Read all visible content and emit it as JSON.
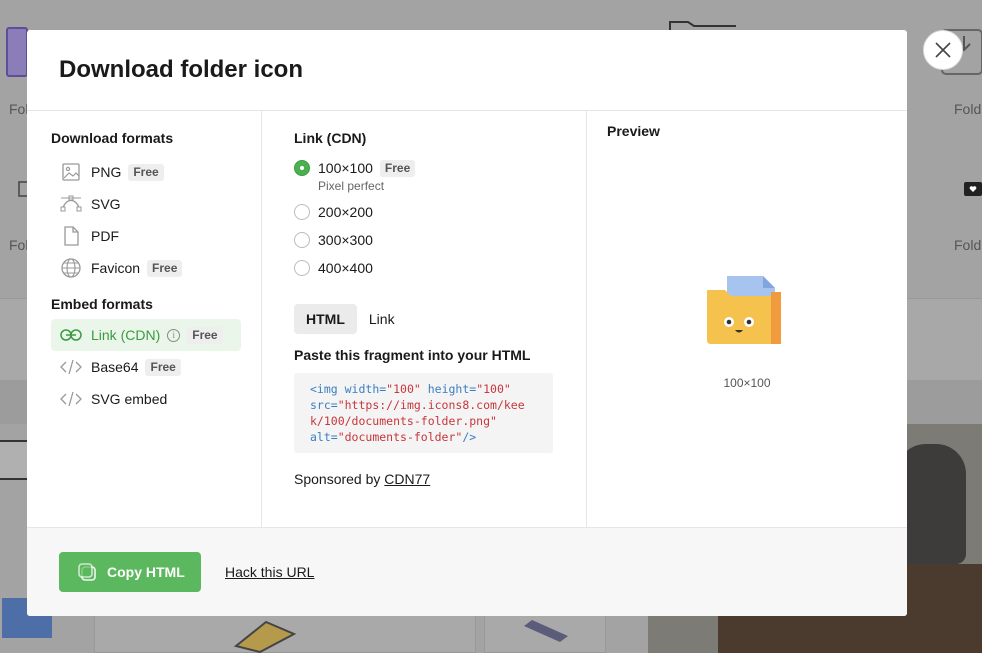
{
  "background": {
    "labels": [
      "Fol",
      "Fold",
      "Fol",
      "Fold"
    ]
  },
  "modal": {
    "title": "Download folder icon",
    "close_icon": "close-icon"
  },
  "download_formats": {
    "heading": "Download formats",
    "items": [
      {
        "label": "PNG",
        "badge": "Free",
        "icon": "image-icon"
      },
      {
        "label": "SVG",
        "badge": "",
        "icon": "vector-icon"
      },
      {
        "label": "PDF",
        "badge": "",
        "icon": "file-icon"
      },
      {
        "label": "Favicon",
        "badge": "Free",
        "icon": "globe-icon"
      }
    ]
  },
  "embed_formats": {
    "heading": "Embed formats",
    "items": [
      {
        "label": "Link (CDN)",
        "badge": "Free",
        "icon": "link-icon",
        "info": "i",
        "active": true
      },
      {
        "label": "Base64",
        "badge": "Free",
        "icon": "code-icon"
      },
      {
        "label": "SVG embed",
        "badge": "",
        "icon": "code-icon"
      }
    ]
  },
  "link_cdn": {
    "heading": "Link (CDN)",
    "sizes": [
      {
        "label": "100×100",
        "badge": "Free",
        "sub": "Pixel perfect",
        "selected": true
      },
      {
        "label": "200×200",
        "selected": false
      },
      {
        "label": "300×300",
        "selected": false
      },
      {
        "label": "400×400",
        "selected": false
      }
    ],
    "tabs": [
      "HTML",
      "Link"
    ],
    "active_tab": "HTML",
    "paste_heading": "Paste this fragment into your HTML",
    "code": {
      "l1_open": "<img ",
      "l1_a1": "width=",
      "l1_v1": "\"100\"",
      "l1_a2": " height=",
      "l1_v2": "\"100\"",
      "l2_a": "src=",
      "l2_v": "\"https://img.icons8.com/kee",
      "l3_v": "k/100/documents-folder.png\"",
      "l4_a": "alt=",
      "l4_v": "\"documents-folder\"",
      "l4_close": "/>"
    },
    "sponsor_prefix": "Sponsored by ",
    "sponsor_link": "CDN77"
  },
  "preview": {
    "heading": "Preview",
    "size_label": "100×100",
    "icon": "documents-folder-icon",
    "colors": {
      "folder": "#f5c24d",
      "paper": "#a7c4ee",
      "tab": "#f09b3e"
    }
  },
  "footer": {
    "copy_label": "Copy HTML",
    "hack_label": "Hack this URL",
    "accent": "#5cb85f"
  }
}
